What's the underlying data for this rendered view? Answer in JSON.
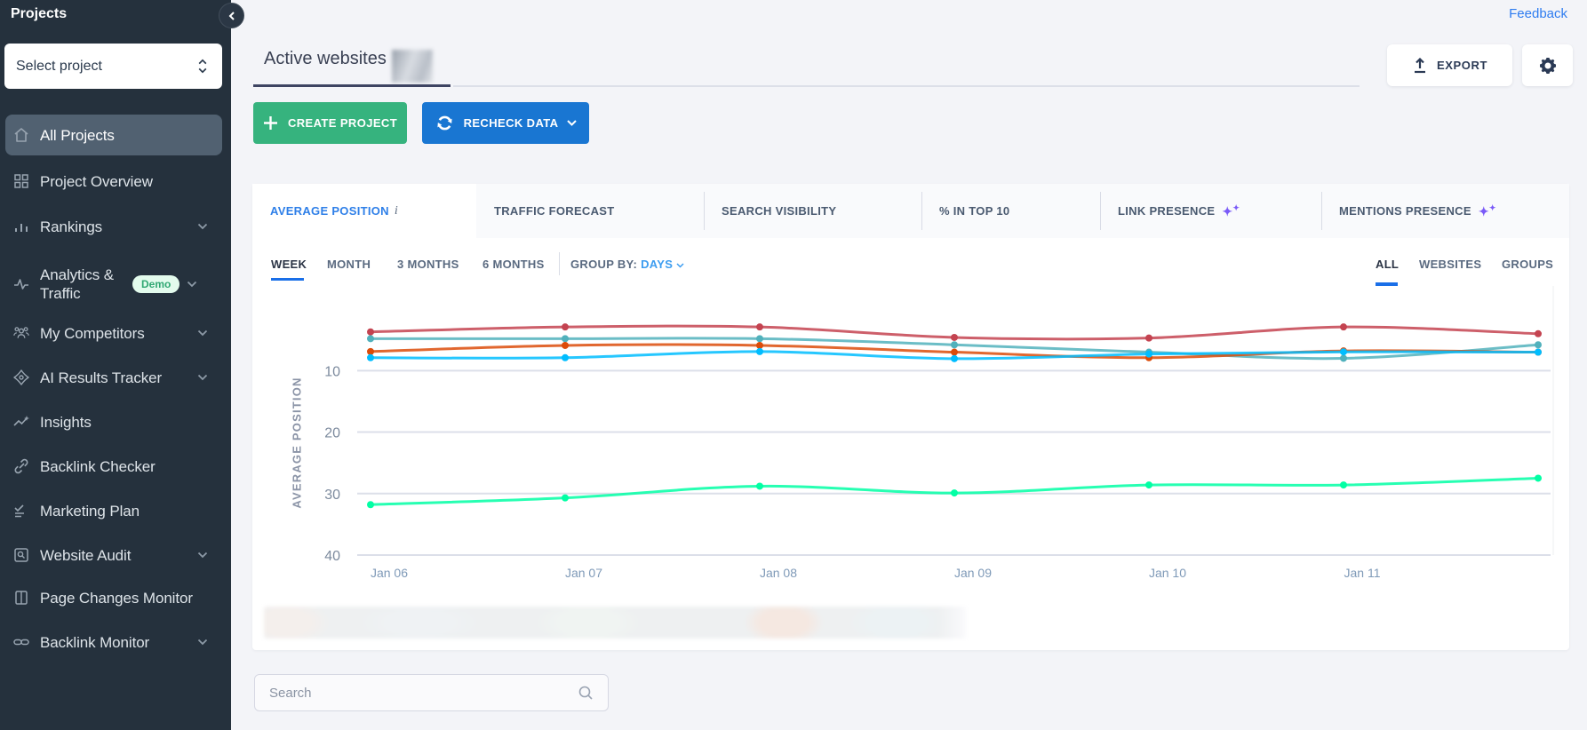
{
  "sidebar": {
    "title": "Projects",
    "select_placeholder": "Select project",
    "items": [
      {
        "label": "All Projects",
        "icon": "home-icon",
        "selected": true,
        "expandable": false
      },
      {
        "label": "Project Overview",
        "icon": "grid-icon",
        "selected": false,
        "expandable": false
      },
      {
        "label": "Rankings",
        "icon": "bar-chart-icon",
        "selected": false,
        "expandable": true
      },
      {
        "label": "Analytics & Traffic",
        "icon": "pulse-icon",
        "selected": false,
        "expandable": true,
        "badge": "Demo",
        "twoline": true
      },
      {
        "label": "My Competitors",
        "icon": "people-icon",
        "selected": false,
        "expandable": true
      },
      {
        "label": "AI Results Tracker",
        "icon": "ai-icon",
        "selected": false,
        "expandable": true
      },
      {
        "label": "Insights",
        "icon": "trend-icon",
        "selected": false,
        "expandable": false
      },
      {
        "label": "Backlink Checker",
        "icon": "link-icon",
        "selected": false,
        "expandable": false
      },
      {
        "label": "Marketing Plan",
        "icon": "checklist-icon",
        "selected": false,
        "expandable": false
      },
      {
        "label": "Website Audit",
        "icon": "audit-icon",
        "selected": false,
        "expandable": true
      },
      {
        "label": "Page Changes Monitor",
        "icon": "pages-icon",
        "selected": false,
        "expandable": false
      },
      {
        "label": "Backlink Monitor",
        "icon": "chain-icon",
        "selected": false,
        "expandable": true
      }
    ]
  },
  "topbar": {
    "feedback_link": "Feedback",
    "export_label": "EXPORT"
  },
  "page_tabs": {
    "active_tab": "Active websites"
  },
  "actions": {
    "create_project": "CREATE PROJECT",
    "recheck_data": "RECHECK DATA"
  },
  "metric_tabs": [
    {
      "label": "AVERAGE POSITION",
      "active": true,
      "info": true,
      "sparkle": false
    },
    {
      "label": "TRAFFIC FORECAST",
      "active": false,
      "info": false,
      "sparkle": false
    },
    {
      "label": "SEARCH VISIBILITY",
      "active": false,
      "info": false,
      "sparkle": false
    },
    {
      "label": "% IN TOP 10",
      "active": false,
      "info": false,
      "sparkle": false
    },
    {
      "label": "LINK PRESENCE",
      "active": false,
      "info": false,
      "sparkle": true
    },
    {
      "label": "MENTIONS PRESENCE",
      "active": false,
      "info": false,
      "sparkle": true
    }
  ],
  "time_filters": [
    {
      "label": "WEEK",
      "active": true
    },
    {
      "label": "MONTH",
      "active": false
    },
    {
      "label": "3 MONTHS",
      "active": false
    },
    {
      "label": "6 MONTHS",
      "active": false
    }
  ],
  "group_by": {
    "label": "GROUP BY:",
    "value": "DAYS"
  },
  "scope_tabs": [
    {
      "label": "ALL",
      "active": true
    },
    {
      "label": "WEBSITES",
      "active": false
    },
    {
      "label": "GROUPS",
      "active": false
    }
  ],
  "search": {
    "placeholder": "Search"
  },
  "chart_data": {
    "type": "line",
    "title": "",
    "ylabel": "AVERAGE POSITION",
    "y_ticks": [
      10,
      20,
      30,
      40
    ],
    "y_inverted": true,
    "x_labels": [
      "Jan 06",
      "Jan 07",
      "Jan 08",
      "Jan 09",
      "Jan 10",
      "Jan 11"
    ],
    "series": [
      {
        "name": "series-red",
        "color": "#c44350",
        "values": [
          3.7,
          2.9,
          2.9,
          4.6,
          4.7,
          2.9,
          4.0
        ]
      },
      {
        "name": "series-teal",
        "color": "#51b1bc",
        "values": [
          4.8,
          4.8,
          4.8,
          5.8,
          7.0,
          8.0,
          5.8
        ]
      },
      {
        "name": "series-orange",
        "color": "#dc4c0a",
        "values": [
          6.9,
          5.9,
          5.9,
          7.0,
          7.9,
          6.8,
          7.0
        ]
      },
      {
        "name": "series-blue",
        "color": "#00bdff",
        "values": [
          7.9,
          7.9,
          6.9,
          8.05,
          7.3,
          6.95,
          7.0
        ]
      },
      {
        "name": "series-green",
        "color": "#01ffa4",
        "values": [
          31.8,
          30.7,
          28.8,
          29.9,
          28.6,
          28.6,
          27.5
        ]
      }
    ]
  }
}
